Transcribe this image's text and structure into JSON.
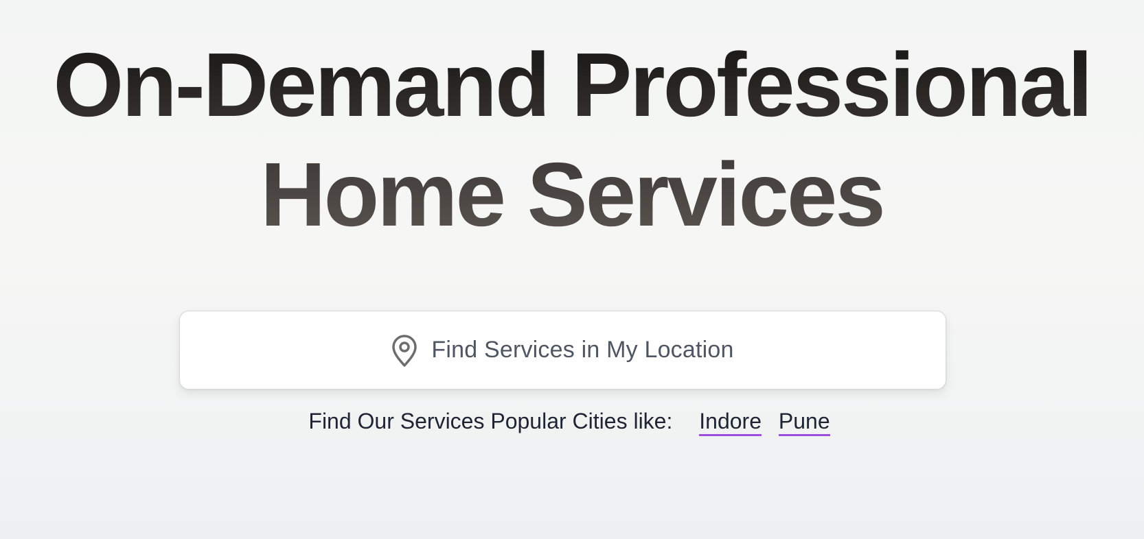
{
  "hero": {
    "title_line1": "On-Demand Professional",
    "title_line2": "Home Services"
  },
  "location_button": {
    "label": "Find Services in My Location",
    "icon": "map-pin-icon"
  },
  "popular_cities": {
    "prefix": "Find Our Services Popular Cities like:",
    "cities": [
      "Indore",
      "Pune"
    ]
  },
  "colors": {
    "title_dark": "#151412",
    "title_light": "#5d5753",
    "link_underline": "#9b4fdc",
    "button_text": "#4e5662",
    "icon_stroke": "#6d6d6d"
  }
}
